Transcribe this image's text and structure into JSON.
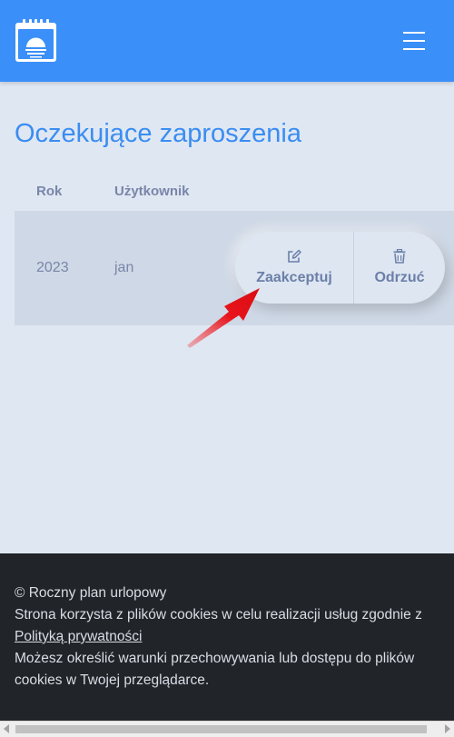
{
  "header": {
    "logo_icon": "calendar-sunset-icon",
    "menu_icon": "hamburger-menu-icon",
    "accent_color": "#3b8ff8"
  },
  "main": {
    "title": "Oczekujące zaproszenia",
    "table": {
      "columns": [
        "Rok",
        "Użytkownik"
      ],
      "rows": [
        {
          "year": "2023",
          "user": "jan",
          "actions": {
            "accept_label": "Zaakceptuj",
            "accept_icon": "edit-icon",
            "reject_label": "Odrzuć",
            "reject_icon": "trash-icon"
          }
        }
      ]
    }
  },
  "footer": {
    "copyright": "© Roczny plan urlopowy",
    "cookies_text": "Strona korzysta z plików cookies w celu realizacji usług zgodnie z",
    "privacy_link": "Polityką prywatności",
    "storage_text": "Możesz określić warunki przechowywania lub dostępu do plików cookies w Twojej przeglądarce."
  },
  "annotation": {
    "arrow_color": "#e8141b"
  }
}
